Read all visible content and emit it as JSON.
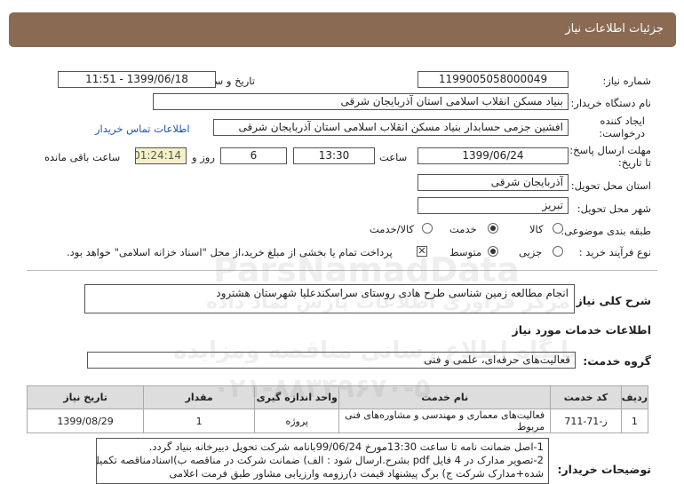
{
  "header": {
    "title": "جزئیات اطلاعات نیاز"
  },
  "form": {
    "need_number": {
      "label": "شماره نیاز:",
      "value": "1199005058000049"
    },
    "announce_datetime": {
      "label": "تاریخ و ساعت اعلان عمومی:",
      "value": "1399/06/18 - 11:51"
    },
    "buyer_org": {
      "label": "نام دستگاه خریدار:",
      "value": "بنیاد مسکن انقلاب اسلامی استان آذربایجان شرقی"
    },
    "requester": {
      "label_line1": "ایجاد کننده",
      "label_line2": "درخواست:",
      "value": "افشین جزمی حسابدار بنیاد مسکن انقلاب اسلامی استان آذربایجان شرقی"
    },
    "contact_link": "اطلاعات تماس خریدار",
    "deadline": {
      "label_line1": "مهلت ارسال پاسخ:",
      "label_line2": "تا تاریخ:",
      "date": "1399/06/24",
      "time_label": "ساعت",
      "time": "13:30",
      "days": "6",
      "days_label": "روز و",
      "remaining": "01:24:14",
      "remaining_label": "ساعت باقی مانده"
    },
    "province": {
      "label": "استان محل تحویل:",
      "value": "آذربایجان شرقی"
    },
    "city": {
      "label": "شهر محل تحویل:",
      "value": "تبریز"
    },
    "category": {
      "label": "طبقه بندی موضوعی:",
      "options": [
        {
          "label": "کالا",
          "selected": false
        },
        {
          "label": "خدمت",
          "selected": true
        },
        {
          "label": "کالا/خدمت",
          "selected": false
        }
      ]
    },
    "purchase_type": {
      "label": "نوع فرآیند خرید :",
      "options": [
        {
          "label": "جزیی",
          "selected": false
        },
        {
          "label": "متوسط",
          "selected": true
        }
      ],
      "payment_note": "پرداخت تمام یا بخشی از مبلغ خرید،از محل \"اسناد خزانه اسلامی\" خواهد بود.",
      "payment_checked": true
    }
  },
  "summary": {
    "label": "شرح کلی نیاز:",
    "value": "انجام مطالعه زمین شناسی طرح هادی روستای سراسکندعلیا شهرستان هشترود"
  },
  "services_section": {
    "title": "اطلاعات خدمات مورد نیاز"
  },
  "service_group": {
    "label": "گروه خدمت:",
    "value": "فعالیت‌های حرفه‌ای، علمی و فنی"
  },
  "table": {
    "headers": [
      "ردیف",
      "کد خدمت",
      "نام خدمت",
      "واحد اندازه گیری",
      "مقدار",
      "تاریخ نیاز"
    ],
    "rows": [
      [
        "1",
        "ز-71-711",
        "فعالیت‌های معماری و مهندسی و مشاوره‌های فنی مربوط",
        "پروژه",
        "1",
        "1399/08/29"
      ]
    ]
  },
  "notes": {
    "label": "توضیحات خریدار:",
    "lines": [
      "1-اصل ضمانت نامه تا ساعت 13:30مورخ 99/06/24بانامه شرکت تحویل دبیرخانه بنیاد گردد.",
      "2-تصویر مدارک در 4 فایل pdf بشرح.ارسال شود : الف) ضمانت شرکت در مناقصه ب)اسنادمناقصه تکمیل",
      "شده+مدارک شرکت ج) برگ پیشنهاد قیمت  د)رزومه وارزیابی مشاور طبق فرمت اعلامی"
    ]
  },
  "watermarks": [
    "ParsNamadData",
    "مرکز فراوری اطلاعات پارس نماد داده",
    "پایگاه اطلاع رسانی مناقصه ومزایده",
    "۰۲۱-۸۸۳۴۹۶۷۰-۵"
  ]
}
